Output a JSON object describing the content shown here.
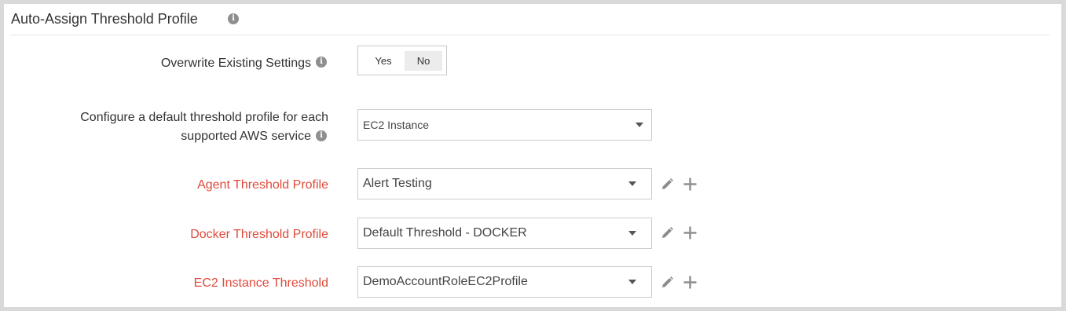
{
  "section": {
    "title": "Auto-Assign Threshold Profile",
    "info_icon": "info-icon"
  },
  "overwrite": {
    "label": "Overwrite Existing Settings",
    "info_icon": "info-icon",
    "options": [
      "Yes",
      "No"
    ],
    "selected": "No"
  },
  "aws_service": {
    "label_line1": "Configure a default threshold profile for each",
    "label_line2": "supported AWS service",
    "info_icon": "info-icon",
    "value": "EC2 Instance"
  },
  "profiles": [
    {
      "label": "Agent Threshold Profile",
      "value": "Alert Testing",
      "edit_icon": "pencil-icon",
      "add_icon": "plus-icon"
    },
    {
      "label": "Docker Threshold Profile",
      "value": "Default Threshold - DOCKER",
      "edit_icon": "pencil-icon",
      "add_icon": "plus-icon"
    },
    {
      "label": "EC2 Instance Threshold",
      "value": "DemoAccountRoleEC2Profile",
      "edit_icon": "pencil-icon",
      "add_icon": "plus-icon"
    }
  ],
  "colors": {
    "required_label": "#e04a3a",
    "text": "#333333",
    "background_frame": "#d9d9d9"
  }
}
